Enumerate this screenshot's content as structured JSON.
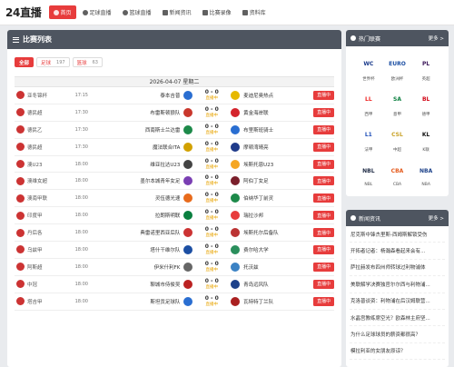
{
  "header": {
    "logo": "24直播",
    "nav": [
      {
        "label": "首页",
        "icon": "home-icon",
        "active": true
      },
      {
        "label": "足球直播",
        "icon": "soccer-ball-icon",
        "active": false
      },
      {
        "label": "篮球直播",
        "icon": "basketball-icon",
        "active": false
      },
      {
        "label": "新闻资讯",
        "icon": "newspaper-icon",
        "active": false
      },
      {
        "label": "比赛录像",
        "icon": "video-icon",
        "active": false
      },
      {
        "label": "资料库",
        "icon": "database-icon",
        "active": false
      }
    ]
  },
  "matches_panel": {
    "title": "比赛列表",
    "filters": [
      {
        "label": "全部",
        "count": "",
        "active": true
      },
      {
        "label": "足球",
        "count": "197",
        "active": false
      },
      {
        "label": "篮球",
        "count": "63",
        "active": false
      }
    ],
    "date": "2026-04-07 星期二",
    "live_label": "直播中",
    "rows": [
      {
        "league": "亚冬锦杯",
        "time": "17:15",
        "home": "泰本吉普",
        "score": "0 - 0",
        "status": "直播中",
        "away": "麦迪尼奥热点"
      },
      {
        "league": "德民超",
        "time": "17:30",
        "home": "布雷斯顿狼队",
        "score": "0 - 0",
        "status": "直播中",
        "away": "黄金海岸联"
      },
      {
        "league": "德民乙",
        "time": "17:30",
        "home": "西南斯士兰达雷",
        "score": "0 - 0",
        "status": "直播中",
        "away": "布里斯班骑士"
      },
      {
        "league": "德民超",
        "time": "17:30",
        "home": "魔法联合ITA",
        "score": "0 - 0",
        "status": "直播中",
        "away": "摩顿湾晴亮"
      },
      {
        "league": "澳U23",
        "time": "18:00",
        "home": "维亚拉达U23",
        "score": "0 - 0",
        "status": "直播中",
        "away": "埃斯托恩U23"
      },
      {
        "league": "澳维女超",
        "time": "18:00",
        "home": "墨尔本城青年女足",
        "score": "0 - 0",
        "status": "直播中",
        "away": "阿伯丁女足"
      },
      {
        "league": "澳南甲联",
        "time": "18:00",
        "home": "灵伍德光速",
        "score": "0 - 0",
        "status": "直播中",
        "away": "伯纳华丁前灵"
      },
      {
        "league": "印度甲",
        "time": "18:00",
        "home": "拉朗斯明联",
        "score": "0 - 0",
        "status": "直播中",
        "away": "瑞拉沙邦"
      },
      {
        "league": "丹后各",
        "time": "18:00",
        "home": "典雷诺里西亚后队",
        "score": "0 - 0",
        "status": "直播中",
        "away": "埃斯托尔后备队"
      },
      {
        "league": "乌兹甲",
        "time": "18:00",
        "home": "塔什干维尔队",
        "score": "0 - 0",
        "status": "直播中",
        "away": "费尔哈大学"
      },
      {
        "league": "阿斯超",
        "time": "18:00",
        "home": "伊米什利FK",
        "score": "0 - 0",
        "status": "直播中",
        "away": "托沃兹"
      },
      {
        "league": "中冠",
        "time": "18:00",
        "home": "聊城市侍俊吴",
        "score": "0 - 0",
        "status": "直播中",
        "away": "青岛远风队"
      },
      {
        "league": "塔吉甲",
        "time": "18:00",
        "home": "斯坦贡足球队",
        "score": "0 - 0",
        "status": "直播中",
        "away": "瓦特特丁兰队"
      }
    ]
  },
  "hot_leagues": {
    "title": "热门联赛",
    "more": "更多 >",
    "items": [
      {
        "name": "世界杯",
        "abbr": "WC",
        "color": "#1a3b8c"
      },
      {
        "name": "欧洲杯",
        "abbr": "EURO",
        "color": "#1c4fa3"
      },
      {
        "name": "英超",
        "abbr": "PL",
        "color": "#3d195b"
      },
      {
        "name": "西甲",
        "abbr": "LL",
        "color": "#ee2523"
      },
      {
        "name": "意甲",
        "abbr": "SA",
        "color": "#0a7f3f"
      },
      {
        "name": "德甲",
        "abbr": "BL",
        "color": "#d20515"
      },
      {
        "name": "法甲",
        "abbr": "L1",
        "color": "#1f4fb8"
      },
      {
        "name": "中超",
        "abbr": "CSL",
        "color": "#c9a227"
      },
      {
        "name": "K联",
        "abbr": "KL",
        "color": "#111111"
      },
      {
        "name": "NBL",
        "abbr": "NBL",
        "color": "#1e2a44"
      },
      {
        "name": "CBA",
        "abbr": "CBA",
        "color": "#e55a1c"
      },
      {
        "name": "NBA",
        "abbr": "NBA",
        "color": "#1d428a"
      }
    ]
  },
  "news": {
    "title": "新闻资讯",
    "more": "更多 >",
    "items": [
      "尼克斯中锋杰里斯-西姆斯解锁受伤",
      "开拓者记者：杨瀚森看起来会有...",
      "萨拉赫发布四州师转球过利物浦体",
      "美联解学决赛独官尔尔西与利物浦...",
      "克洛普谈资：利物浦在后汉姆联营...",
      "水晶宫教练席空光？欧森林主府坚...",
      "为什么足球球员的薪资都很高？",
      "模拉利亚的女朋友原谅？"
    ]
  }
}
